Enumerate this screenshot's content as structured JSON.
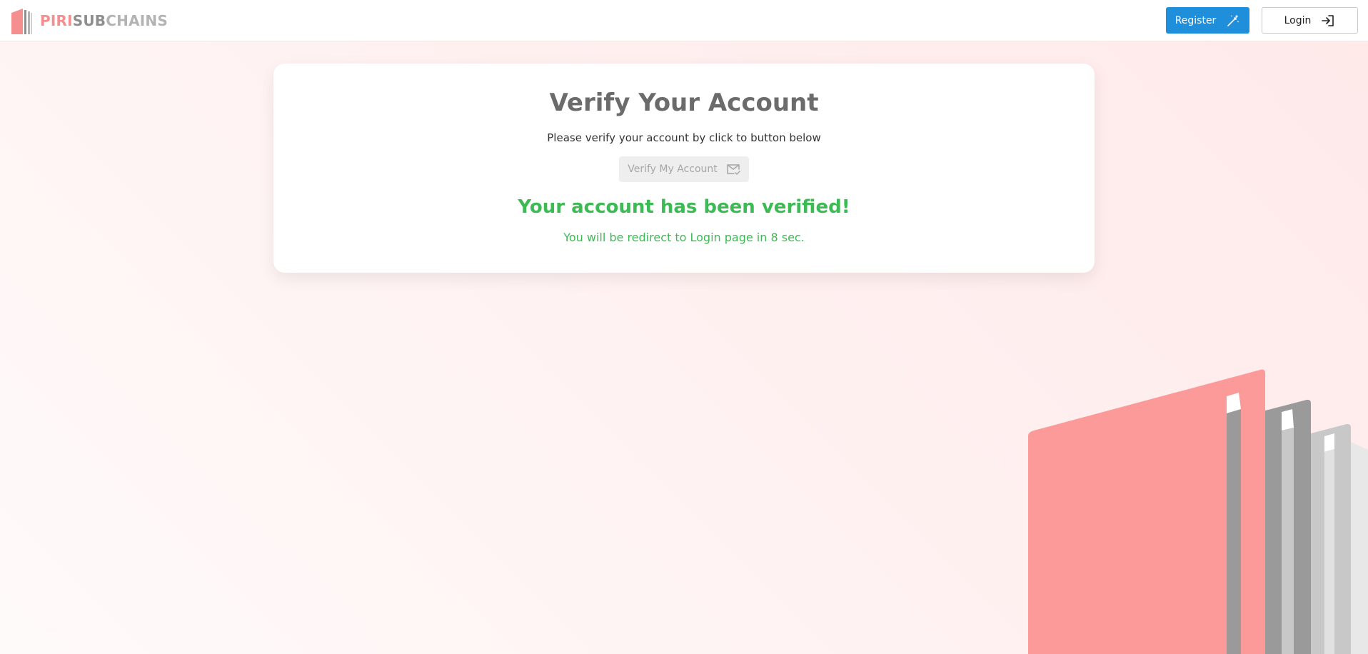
{
  "brand": {
    "piri": "PIRI",
    "sub": "SUB",
    "chains": "CHAINS",
    "color_primary": "#f58f8f",
    "color_secondary": "#8e8e8e"
  },
  "nav": {
    "register_label": "Register",
    "register_icon": "magic-wand-icon",
    "login_label": "Login",
    "login_icon": "login-icon"
  },
  "card": {
    "title": "Verify Your Account",
    "subtitle": "Please verify your account by click to button below",
    "verify_button_label": "Verify My Account",
    "verify_button_icon": "mail-check-icon",
    "success_message": "Your account has been verified!",
    "redirect_message": "You will be redirect to Login page in 8 sec."
  },
  "colors": {
    "accent_blue": "#1f8fdc",
    "success_green": "#3cba54",
    "brand_pink": "#f58f8f"
  }
}
